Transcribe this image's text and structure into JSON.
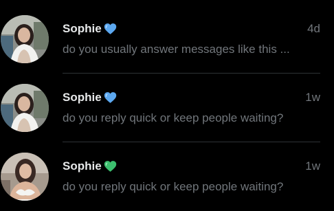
{
  "conversations": [
    {
      "name": "Sophie",
      "heart_icon": "blue-heart-icon",
      "heart_color": "#5ca8f0",
      "time": "4d",
      "preview": "do you usually answer messages like this ..."
    },
    {
      "name": "Sophie",
      "heart_icon": "blue-heart-icon",
      "heart_color": "#5ca8f0",
      "time": "1w",
      "preview": "do you reply quick or keep people waiting?"
    },
    {
      "name": "Sophie",
      "heart_icon": "green-heart-icon",
      "heart_color": "#3cbf6e",
      "time": "1w",
      "preview": "do you reply quick or keep people waiting?"
    }
  ],
  "colors": {
    "background": "#000000",
    "name_text": "#e7e9ea",
    "secondary_text": "#71767b",
    "divider": "#2f3336"
  }
}
